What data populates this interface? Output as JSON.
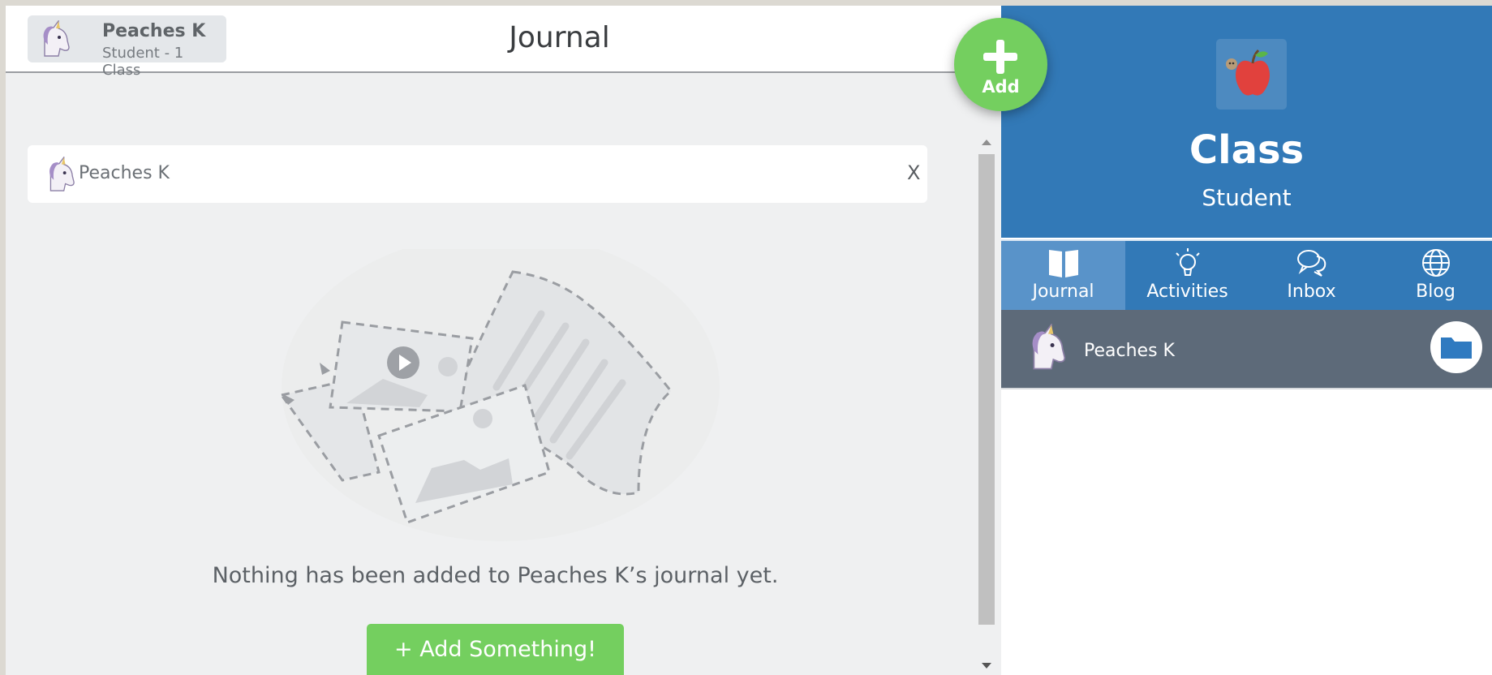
{
  "header": {
    "user_name": "Peaches K",
    "user_subtitle": "Student - 1 Class",
    "page_title": "Journal"
  },
  "filter": {
    "name": "Peaches K",
    "close_label": "X"
  },
  "empty_state": {
    "message": "Nothing has been added to Peaches K’s journal yet.",
    "button_label": "+ Add Something!"
  },
  "fab": {
    "label": "Add"
  },
  "class_panel": {
    "title": "Class",
    "role": "Student",
    "tabs": [
      {
        "label": "Journal",
        "icon": "book-icon",
        "active": true
      },
      {
        "label": "Activities",
        "icon": "lightbulb-icon",
        "active": false
      },
      {
        "label": "Inbox",
        "icon": "chat-bubbles-icon",
        "active": false
      },
      {
        "label": "Blog",
        "icon": "globe-icon",
        "active": false
      }
    ],
    "members": [
      {
        "name": "Peaches K",
        "avatar": "unicorn-icon"
      }
    ]
  },
  "colors": {
    "brand_blue": "#3279b7",
    "active_tab": "#5993c9",
    "accent_green": "#74cf5f",
    "member_row": "#5d6a79"
  }
}
